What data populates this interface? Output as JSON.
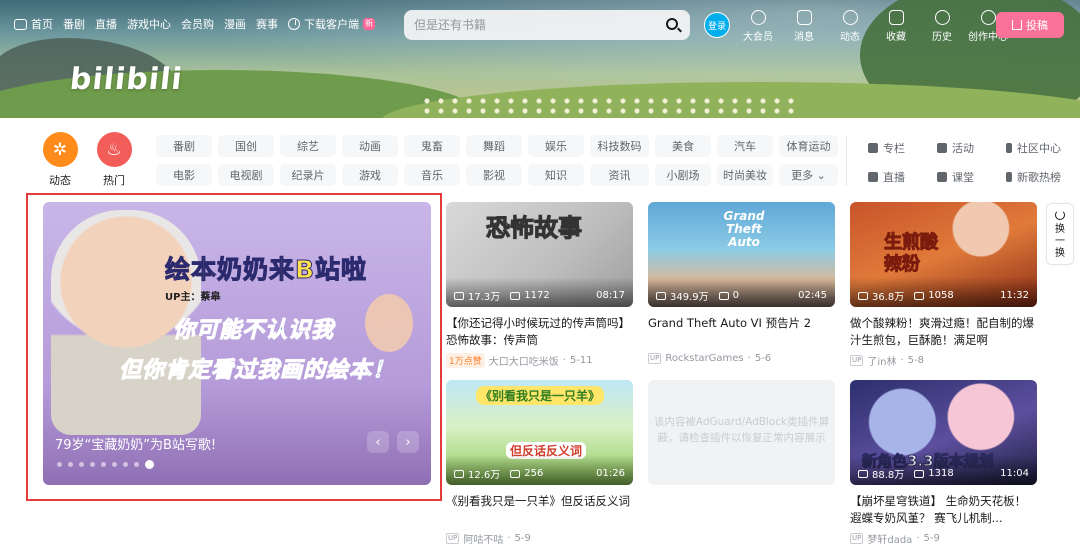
{
  "header": {
    "logo": "bilibili",
    "nav_left": [
      {
        "label": "首页",
        "icon": "tv-icon"
      },
      {
        "label": "番剧"
      },
      {
        "label": "直播"
      },
      {
        "label": "游戏中心"
      },
      {
        "label": "会员购"
      },
      {
        "label": "漫画"
      },
      {
        "label": "赛事"
      },
      {
        "label": "下载客户端",
        "icon": "download-icon",
        "badge": "新"
      }
    ],
    "search_placeholder": "但是还有书籍",
    "login": "登录",
    "nav_right": [
      {
        "label": "大会员",
        "icon": "vip-icon"
      },
      {
        "label": "消息",
        "icon": "message-icon"
      },
      {
        "label": "动态",
        "icon": "dynamic-icon"
      },
      {
        "label": "收藏",
        "icon": "star-icon"
      },
      {
        "label": "历史",
        "icon": "clock-icon"
      },
      {
        "label": "创作中心",
        "icon": "bulb-icon"
      }
    ],
    "upload": "投稿"
  },
  "channels": {
    "dynamic": "动态",
    "hot": "热门",
    "row1": [
      "番剧",
      "国创",
      "综艺",
      "动画",
      "鬼畜",
      "舞蹈",
      "娱乐",
      "科技数码",
      "美食",
      "汽车",
      "体育运动"
    ],
    "row2": [
      "电影",
      "电视剧",
      "纪录片",
      "游戏",
      "音乐",
      "影视",
      "知识",
      "资讯",
      "小剧场",
      "时尚美妆",
      "更多"
    ],
    "side_row1": [
      "专栏",
      "活动",
      "社区中心"
    ],
    "side_row2": [
      "直播",
      "课堂",
      "新歌热榜"
    ]
  },
  "carousel": {
    "title_line": "绘本奶奶来B站啦",
    "up_line": "UP主：蔡皋",
    "line2": "你可能不认识我",
    "line3": "但你肯定看过我画的绘本！",
    "caption": "79岁“宝藏奶奶”为B站写歌!",
    "prev": "‹",
    "next": "›",
    "dot_count": 9,
    "active_dot": 8
  },
  "videos": [
    {
      "thumb_text": "恐怖故事",
      "views": "17.3万",
      "danmaku": "1172",
      "duration": "08:17",
      "title": "【你还记得小时候玩过的传声筒吗】恐怖故事：传声筒",
      "badge": "1万点赞",
      "up": "大口大口吃米饭",
      "date": "5-11"
    },
    {
      "thumb_text": "Grand Theft Auto",
      "views": "349.9万",
      "danmaku": "0",
      "duration": "02:45",
      "title": "Grand Theft Auto VI 预告片 2",
      "up": "RockstarGames",
      "date": "5-6"
    },
    {
      "thumb_text": "生煎酸辣粉",
      "views": "36.8万",
      "danmaku": "1058",
      "duration": "11:32",
      "title": "做个酸辣粉！爽滑过瘾！配自制的爆汁生煎包，巨酥脆！满足啊",
      "up": "了in林",
      "date": "5-8"
    },
    {
      "thumb_text": "《别看我只是一只羊》",
      "thumb_text2": "但反话反义词",
      "views": "12.6万",
      "danmaku": "256",
      "duration": "01:26",
      "title": "《别看我只是一只羊》但反话反义词",
      "up": "阿咕不咕",
      "date": "5-9"
    },
    {
      "thumb_text": "新角色3.3版本规划",
      "views": "88.8万",
      "danmaku": "1318",
      "duration": "11:04",
      "title": "【崩坏星穹铁道】 生命奶天花板！ 遐蝶专奶风堇？ 赛飞儿机制...",
      "up": "梦轩dada",
      "date": "5-9"
    }
  ],
  "ad_placeholder": "该内容被AdGuard/AdBlock类插件屏蔽，请检查插件以恢复正常内容展示",
  "refresh": {
    "label1": "换",
    "label2": "一",
    "label3": "换"
  },
  "colors": {
    "accent_blue": "#00aeec",
    "accent_pink": "#fb7299",
    "dynamic_orange": "#ff8c1a",
    "hot_red": "#f25d59",
    "highlight_red": "#e33b3b"
  },
  "up_badge": "UP"
}
